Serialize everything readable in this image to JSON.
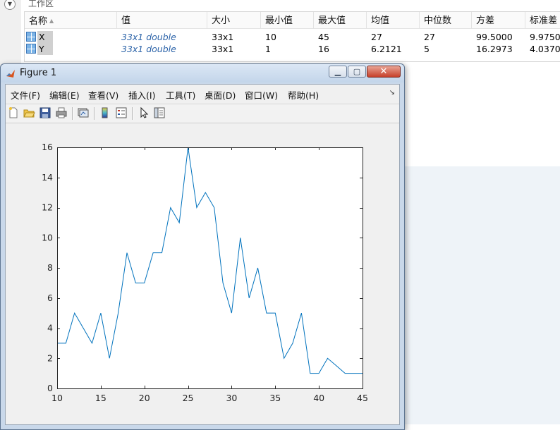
{
  "workspace": {
    "title": "工作区",
    "collapse_glyph": "▼",
    "columns": [
      "名称",
      "值",
      "大小",
      "最小值",
      "最大值",
      "均值",
      "中位数",
      "方差",
      "标准差"
    ],
    "rows": [
      {
        "name": "X",
        "value": "33x1 double",
        "size": "33x1",
        "min": "10",
        "max": "45",
        "mean": "27",
        "median": "27",
        "var": "99.5000",
        "std": "9.9750"
      },
      {
        "name": "Y",
        "value": "33x1 double",
        "size": "33x1",
        "min": "1",
        "max": "16",
        "mean": "6.2121",
        "median": "5",
        "var": "16.2973",
        "std": "4.0370"
      }
    ]
  },
  "figure": {
    "title": "Figure 1",
    "menus": [
      "文件(F)",
      "编辑(E)",
      "查看(V)",
      "插入(I)",
      "工具(T)",
      "桌面(D)",
      "窗口(W)",
      "帮助(H)"
    ],
    "toolbar_icons": [
      "new-figure-icon",
      "open-file-icon",
      "save-icon",
      "print-icon",
      "link-plot-icon",
      "colorbar-icon",
      "legend-icon",
      "pointer-icon",
      "property-editor-icon"
    ]
  },
  "chart_data": {
    "type": "line",
    "title": "",
    "xlabel": "",
    "ylabel": "",
    "xlim": [
      10,
      45
    ],
    "ylim": [
      0,
      16
    ],
    "xticks": [
      10,
      15,
      20,
      25,
      30,
      35,
      40,
      45
    ],
    "yticks": [
      0,
      2,
      4,
      6,
      8,
      10,
      12,
      14,
      16
    ],
    "grid": false,
    "color": "#0072bd",
    "x": [
      10,
      11,
      12,
      13,
      14,
      15,
      16,
      17,
      18,
      19,
      20,
      21,
      22,
      23,
      24,
      25,
      26,
      27,
      28,
      29,
      30,
      31,
      32,
      33,
      34,
      35,
      36,
      37,
      38,
      39,
      40,
      41,
      42,
      43,
      44,
      45
    ],
    "y": [
      3,
      3,
      5,
      4,
      3,
      5,
      2,
      5,
      9,
      7,
      7,
      9,
      9,
      12,
      11,
      16,
      12,
      13,
      12,
      7,
      5,
      10,
      6,
      8,
      5,
      5,
      2,
      3,
      5,
      1,
      1,
      2,
      1.5,
      1,
      1,
      1
    ]
  }
}
